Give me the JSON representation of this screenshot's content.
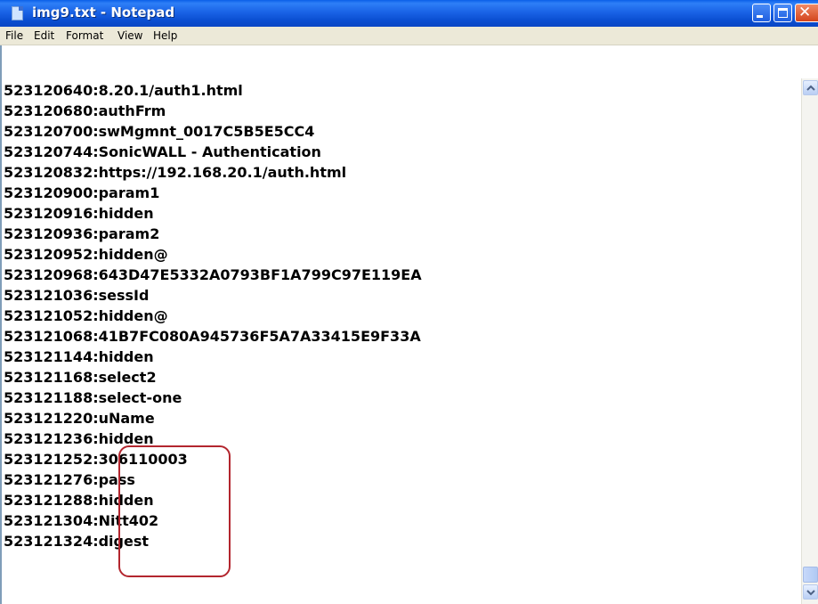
{
  "window": {
    "title": "img9.txt - Notepad"
  },
  "menu": {
    "file": "File",
    "edit": "Edit",
    "format": "Format",
    "view": "View",
    "help": "Help"
  },
  "lines": [
    "523120640:8.20.1/auth1.html",
    "523120680:authFrm",
    "523120700:swMgmnt_0017C5B5E5CC4",
    "523120744:SonicWALL - Authentication",
    "523120832:https://192.168.20.1/auth.html",
    "523120900:param1",
    "523120916:hidden",
    "523120936:param2",
    "523120952:hidden@",
    "523120968:643D47E5332A0793BF1A799C97E119EA",
    "523121036:sessId",
    "523121052:hidden@",
    "523121068:41B7FC080A945736F5A7A33415E9F33A",
    "523121144:hidden",
    "523121168:select2",
    "523121188:select-one",
    "523121220:uName",
    "523121236:hidden",
    "523121252:306110003",
    "523121276:pass",
    "523121288:hidden",
    "523121304:Nitt402",
    "523121324:digest"
  ],
  "annotation": {
    "color": "#b3262e"
  },
  "colors": {
    "titlebar": "#0b4fd2",
    "menubar": "#ece9d8",
    "close_button": "#d3441c"
  }
}
